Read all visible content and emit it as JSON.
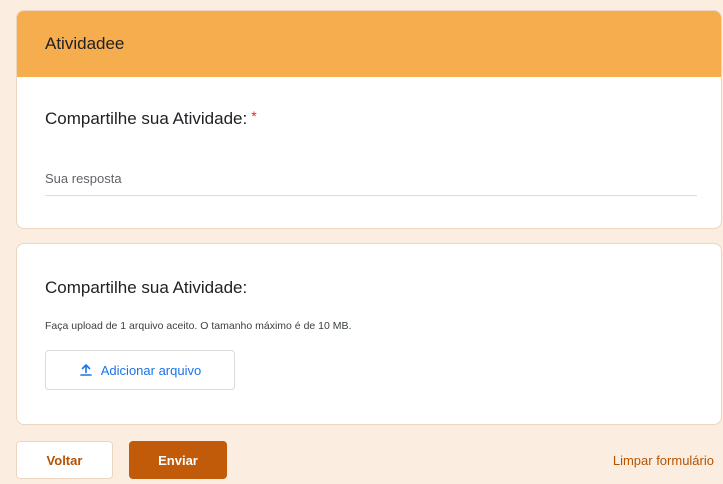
{
  "section": {
    "title": "Atividadee"
  },
  "question1": {
    "title": "Compartilhe sua Atividade:",
    "required_mark": "*",
    "answer_placeholder": "Sua resposta"
  },
  "question2": {
    "title": "Compartilhe sua Atividade:",
    "hint": "Faça upload de 1 arquivo aceito. O tamanho máximo é de 10 MB.",
    "add_file_label": "Adicionar arquivo",
    "add_file_icon": "upload-icon"
  },
  "footer": {
    "back_label": "Voltar",
    "submit_label": "Enviar",
    "clear_label": "Limpar formulário"
  },
  "colors": {
    "accent": "#f6ad4e",
    "primary_button": "#c15a09",
    "link": "#b55300",
    "upload_blue": "#1a73e8",
    "required_red": "#d93025",
    "background": "#fbeee1"
  }
}
